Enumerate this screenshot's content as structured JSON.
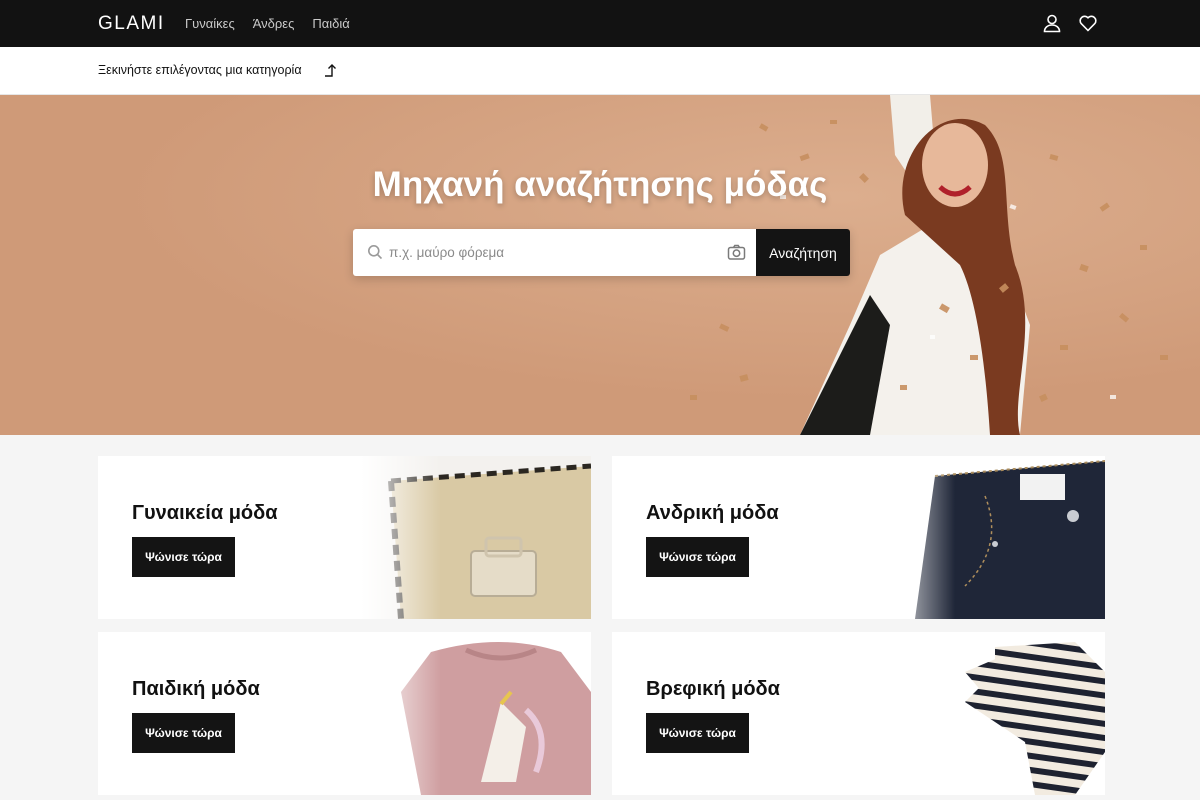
{
  "header": {
    "logo": "GLAMI",
    "nav": [
      "Γυναίκες",
      "Άνδρες",
      "Παιδιά"
    ],
    "icons": [
      "user-icon",
      "heart-icon"
    ]
  },
  "category_bar": {
    "text": "Ξεκινήστε επιλέγοντας μια κατηγορία",
    "icon": "arrow-up-right-icon"
  },
  "hero": {
    "title": "Μηχανή αναζήτησης μόδας",
    "search": {
      "placeholder": "π.χ. μαύρο φόρεμα",
      "value": "",
      "button": "Αναζήτηση"
    },
    "bg_color": "#d4a07f"
  },
  "cards": [
    {
      "title": "Γυναικεία μόδα",
      "button": "Ψώνισε τώρα"
    },
    {
      "title": "Ανδρική μόδα",
      "button": "Ψώνισε τώρα"
    },
    {
      "title": "Παιδική μόδα",
      "button": "Ψώνισε τώρα"
    },
    {
      "title": "Βρεφική μόδα",
      "button": "Ψώνισε τώρα"
    }
  ],
  "colors": {
    "topbar": "#121212",
    "accent_dark": "#141414",
    "page_bg": "#f5f5f5"
  }
}
